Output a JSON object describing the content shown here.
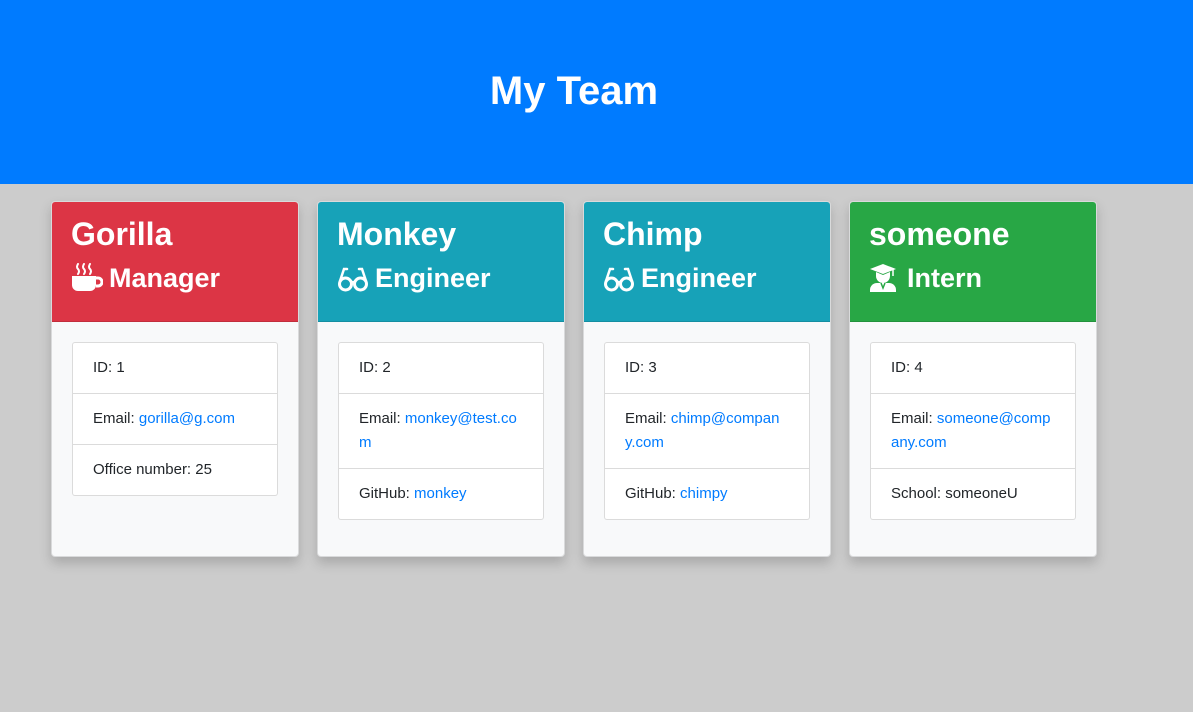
{
  "header": {
    "title": "My Team"
  },
  "colors": {
    "header_bg": "#007bff",
    "manager": "#dc3545",
    "engineer": "#17a2b8",
    "intern": "#28a745",
    "link": "#007bff"
  },
  "cards": [
    {
      "name": "Gorilla",
      "role": "Manager",
      "icon": "mug-icon",
      "id_label": "ID: 1",
      "email_label": "Email:",
      "email": "gorilla@g.com",
      "extra_label": "Office number: 25",
      "extra_link": ""
    },
    {
      "name": "Monkey",
      "role": "Engineer",
      "icon": "glasses-icon",
      "id_label": "ID: 2",
      "email_label": "Email:",
      "email": "monkey@test.com",
      "extra_label": "GitHub:",
      "extra_link": "monkey"
    },
    {
      "name": "Chimp",
      "role": "Engineer",
      "icon": "glasses-icon",
      "id_label": "ID: 3",
      "email_label": "Email:",
      "email": "chimp@company.com",
      "extra_label": "GitHub:",
      "extra_link": "chimpy"
    },
    {
      "name": "someone",
      "role": "Intern",
      "icon": "graduate-icon",
      "id_label": "ID: 4",
      "email_label": "Email:",
      "email": "someone@company.com",
      "extra_label": "School: someoneU",
      "extra_link": ""
    }
  ]
}
